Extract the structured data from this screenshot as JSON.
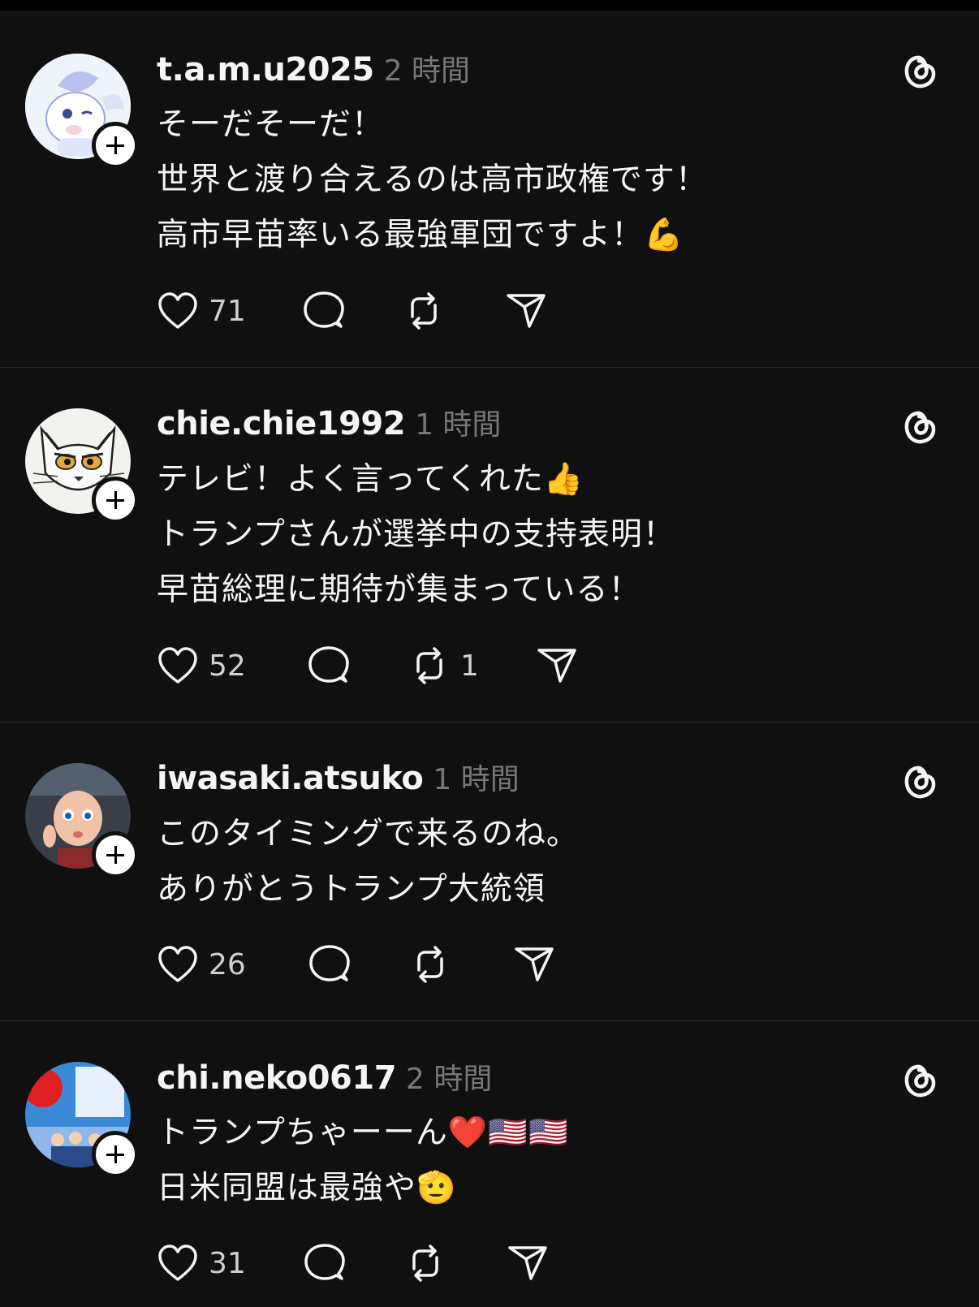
{
  "posts": [
    {
      "username": "t.a.m.u2025",
      "time": "2 時間",
      "lines": [
        "そーだそーだ！",
        "世界と渡り合えるのは高市政権です！",
        "高市早苗率いる最強軍団ですよ！💪"
      ],
      "likes": "71",
      "reposts": ""
    },
    {
      "username": "chie.chie1992",
      "time": "1 時間",
      "lines": [
        "テレビ！よく言ってくれた👍",
        "トランプさんが選挙中の支持表明！",
        "早苗総理に期待が集まっている！"
      ],
      "likes": "52",
      "reposts": "1"
    },
    {
      "username": "iwasaki.atsuko",
      "time": "1 時間",
      "lines": [
        "このタイミングで来るのね。",
        "ありがとうトランプ大統領"
      ],
      "likes": "26",
      "reposts": ""
    },
    {
      "username": "chi.neko0617",
      "time": "2 時間",
      "lines": [
        "トランプちゃーーん❤️🇺🇸🇺🇸",
        "日米同盟は最強や🫡"
      ],
      "likes": "31",
      "reposts": ""
    }
  ]
}
